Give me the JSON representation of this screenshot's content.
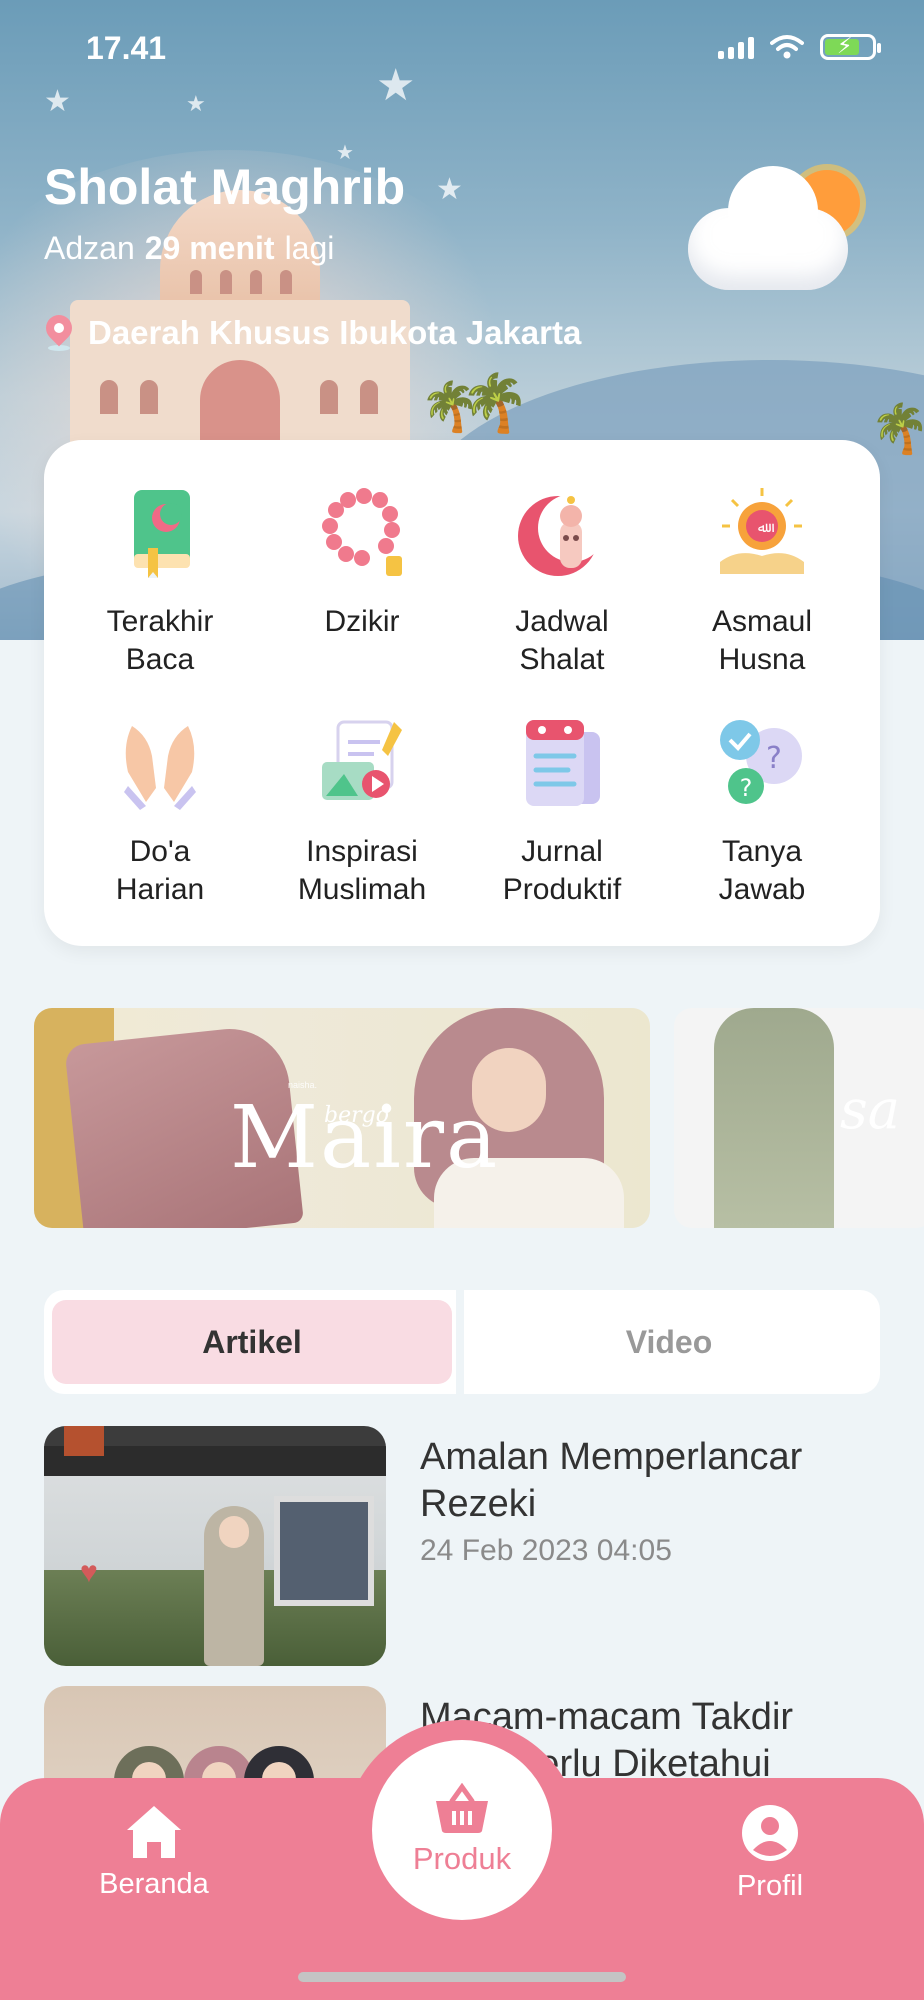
{
  "status_bar": {
    "time": "17.41"
  },
  "header": {
    "prayer_title": "Sholat Maghrib",
    "countdown_prefix": "Adzan",
    "countdown_value": "29 menit",
    "countdown_suffix": "lagi",
    "location": "Daerah Khusus Ibukota Jakarta",
    "weather_icon": "sun-cloud-icon"
  },
  "menu": {
    "items": [
      {
        "label": "Terakhir\nBaca",
        "icon": "quran-book-icon"
      },
      {
        "label": "Dzikir",
        "icon": "prayer-beads-icon"
      },
      {
        "label": "Jadwal\nShalat",
        "icon": "crescent-mosque-icon"
      },
      {
        "label": "Asmaul\nHusna",
        "icon": "allah-calligraphy-icon"
      },
      {
        "label": "Do'a\nHarian",
        "icon": "praying-hands-icon"
      },
      {
        "label": "Inspirasi\nMuslimah",
        "icon": "media-inspiration-icon"
      },
      {
        "label": "Jurnal\nProduktif",
        "icon": "journal-icon"
      },
      {
        "label": "Tanya\nJawab",
        "icon": "question-chat-icon"
      }
    ]
  },
  "banners": [
    {
      "brand": "naisha.",
      "title": "Maira",
      "subtitle": "bergo"
    },
    {
      "title": "sa"
    }
  ],
  "tabs": {
    "active": "Artikel",
    "inactive": "Video"
  },
  "articles": [
    {
      "title": "Amalan Memperlancar Rezeki",
      "date": "24 Feb 2023 04:05"
    },
    {
      "title": "Macam-macam Takdir yang Perlu Diketahui",
      "date": ""
    }
  ],
  "bottom_nav": {
    "home": "Beranda",
    "product": "Produk",
    "profile": "Profil"
  },
  "colors": {
    "accent": "#ee7f95",
    "tab_active_bg": "#f9dce3",
    "background": "#eef4f7"
  }
}
